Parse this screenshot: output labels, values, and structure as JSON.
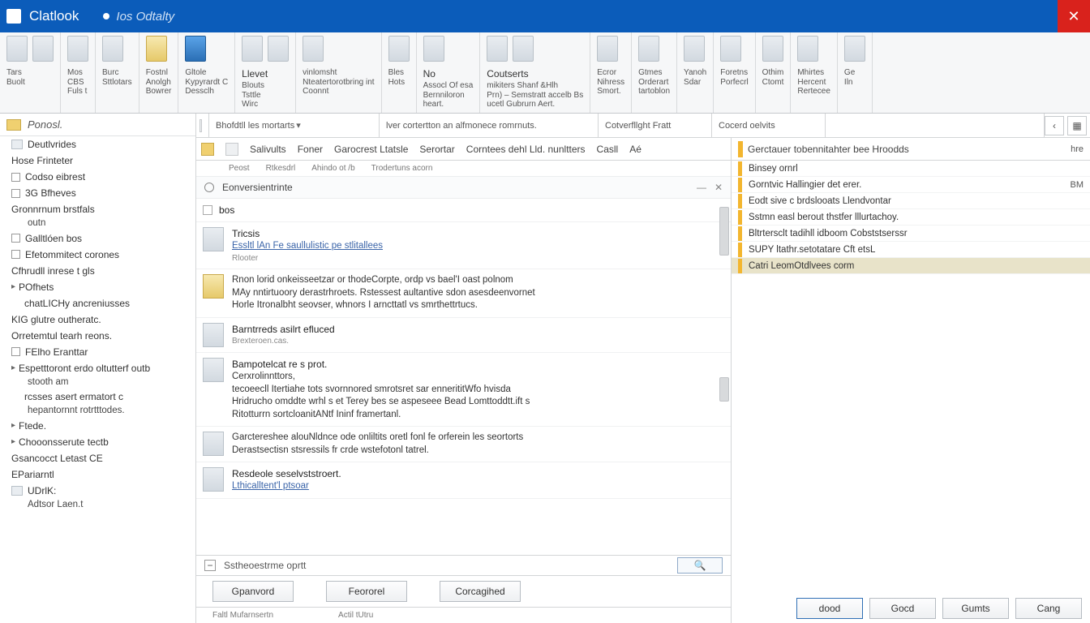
{
  "titlebar": {
    "app": "Clatlook",
    "sub": "Ios Odtalty"
  },
  "ribbon": [
    {
      "header": "",
      "labels": [
        "Tars",
        "Buolt"
      ],
      "sel": false
    },
    {
      "header": "",
      "labels": [
        "Mos",
        "CBS",
        "Fuls t"
      ],
      "sel": false
    },
    {
      "header": "",
      "labels": [
        "Burc",
        "",
        "Sttlotars"
      ],
      "sel": false
    },
    {
      "header": "",
      "labels": [
        "Fostnl",
        "Anolgh",
        "Bowrer"
      ],
      "sel": false,
      "yel": true
    },
    {
      "header": "",
      "labels": [
        "Gltole",
        "Kypyrardt C",
        "Dessclh"
      ],
      "sel": true
    },
    {
      "header": "Llevet",
      "labels": [
        "Blouts",
        "Tsttle",
        "Wirc"
      ],
      "sel": false
    },
    {
      "header": "",
      "labels": [
        "vinlomsht",
        "Nteatertorotbring int",
        "Coonnt"
      ],
      "sel": false
    },
    {
      "header": "",
      "labels": [
        "Bles",
        "",
        "Hots"
      ],
      "sel": false
    },
    {
      "header": "No",
      "labels": [
        "Assocl Of esa",
        "Bernniloron",
        "heart."
      ],
      "sel": false
    },
    {
      "header": "Coutserts",
      "labels": [
        "mikiters Shanf &Hlh",
        "Prn) – Semstratt accelb Bs",
        "ucetl   Gubrurn Aert."
      ],
      "sel": false
    },
    {
      "header": "",
      "labels": [
        "Ecror",
        "Nihress",
        "Smort."
      ],
      "sel": false
    },
    {
      "header": "",
      "labels": [
        "Gtmes",
        "Orderart",
        "tartoblon"
      ],
      "sel": false
    },
    {
      "header": "",
      "labels": [
        "Yanoh",
        "",
        "Sdar"
      ],
      "sel": false
    },
    {
      "header": "",
      "labels": [
        "Foretns",
        "Porfecrl",
        ""
      ],
      "sel": false
    },
    {
      "header": "",
      "labels": [
        "Othim",
        "",
        "Ctomt"
      ],
      "sel": false
    },
    {
      "header": "",
      "labels": [
        "Mhirtes",
        "Hercent",
        "Rertecee"
      ],
      "sel": false
    },
    {
      "header": "",
      "labels": [
        "Ge",
        "",
        "Iln"
      ],
      "sel": false
    }
  ],
  "sidebar": {
    "top": "Ponosl.",
    "items": [
      {
        "t": "Deutlvrides",
        "icon": true
      },
      {
        "t": "Hose Frinteter",
        "sub": ""
      },
      {
        "t": "Codso eibrest",
        "chk": true
      },
      {
        "t": "3G Bfheves",
        "chk": true
      },
      {
        "t": "Gronnrnum brstfals",
        "sub2": "outn"
      },
      {
        "t": "Galltlóen bos",
        "chk": true
      },
      {
        "t": "Efetommitect corones",
        "chk": true
      },
      {
        "t": "Cfhrudll inrese t gls"
      },
      {
        "t": "POfhets",
        "arr": true
      },
      {
        "t": "chatLICHy ancreniusses",
        "sub": true
      },
      {
        "t": "KIG glutre outheratc."
      },
      {
        "t": "Orretemtul tearh reons."
      },
      {
        "t": "FElho Eranttar",
        "chk": true
      },
      {
        "t": "Espetttoront erdo oltutterf outb",
        "arr": true,
        "sub2": "stooth am"
      },
      {
        "t": "rcsses asert ermatort c",
        "sub": true,
        "sub2": "hepantornnt rotrtttodes."
      },
      {
        "t": "Ftede.",
        "arr": true
      },
      {
        "t": "Chooonsserute tectb",
        "arr": true
      },
      {
        "t": "Gsancocct Letast CE"
      },
      {
        "t": "EPariarntl"
      },
      {
        "t": "UDrlK:",
        "icon": true,
        "sub2": "  Adtsor Laen.t"
      }
    ]
  },
  "filterbar": {
    "seg1": "Bhofdtll les mortarts",
    "seg2": "lver cortertton an alfmonece romrnuts.",
    "seg3": "Cotverfllght Fratt",
    "seg4": "Cocerd oelvits"
  },
  "tabs": [
    "Salivults",
    "Foner",
    "Garocrest Ltatsle",
    "Serortar",
    "Corntees dehl Lld. nunltters",
    "Casll",
    "Aé"
  ],
  "subhdr": [
    "",
    "Peost",
    "Rtkesdrl",
    "Ahindo ot /b",
    "Trodertuns acorn"
  ],
  "group": "Eonversientrinte",
  "msgs": [
    {
      "chk": true,
      "title": "bos",
      "bullet": true
    },
    {
      "title": "Tricsis",
      "link": "Essltl lAn Fe saullulistic pe stlitallees",
      "meta": "Rlooter"
    },
    {
      "body": "Rnon lorid onkeisseetzar or thodeCorpte, ordp vs bael'I oast polnom\nMAy nntirtuoory derastrhroets. Rstessest aultantive sdon asesdeenvornet\nHorle Itronalbht seovser, whnors I arncttatl vs smrthettrtucs.",
      "yel": true
    },
    {
      "title": "Barntrreds asilrt efluced",
      "meta": "Brexteroen.cas."
    },
    {
      "title": "Bampotelcat re s prot.",
      "sub": "Cerxrolinnttors,",
      "body": "tecoeecll Itertiahe tots svornnored smrotsret sar ennerititWfo hvisda\nHridrucho omddte wrhl s et Terey bes se aspeseee Bead Lomttoddtt.ift s\nRitotturrn sortcloanitANtf Ininf framertanl."
    },
    {
      "body": "Garctereshee alouNldnce ode onliltits oretl fonl fe orferein les seortorts\nDerastsectisn stsressils fr crde wstefotonl tatrel."
    },
    {
      "title": "Resdeole seselvststroert.",
      "link": "Lthicalltent'l ptsoar"
    }
  ],
  "collapse": "Sstheoestrme oprtt",
  "actions": [
    "Gpanvord",
    "Feororel",
    "Corcagihed"
  ],
  "status": [
    "Faltl Mufarnsertn",
    "Actil tUtru"
  ],
  "righthdr": "Gerctauer tobennitahter bee Hroodds",
  "rightcols": [
    "hre"
  ],
  "rightitems": [
    {
      "t": "Binsey ornrl",
      "c": ""
    },
    {
      "t": "Gorntvic Hallingier det erer.",
      "c": "BM"
    },
    {
      "t": "Eodt sive c brdslooats Llendvontar"
    },
    {
      "t": "Sstmn easl berout thstfer lllurtachoy."
    },
    {
      "t": "Bltrtersclt tadihll idboom Cobststserssr"
    },
    {
      "t": "SUPY ltathr.setotatare Cft etsL"
    },
    {
      "t": "Catri LeomOtdlvees corm",
      "sel": true
    }
  ],
  "footer": [
    "dood",
    "Gocd",
    "Gumts",
    "Cang"
  ]
}
